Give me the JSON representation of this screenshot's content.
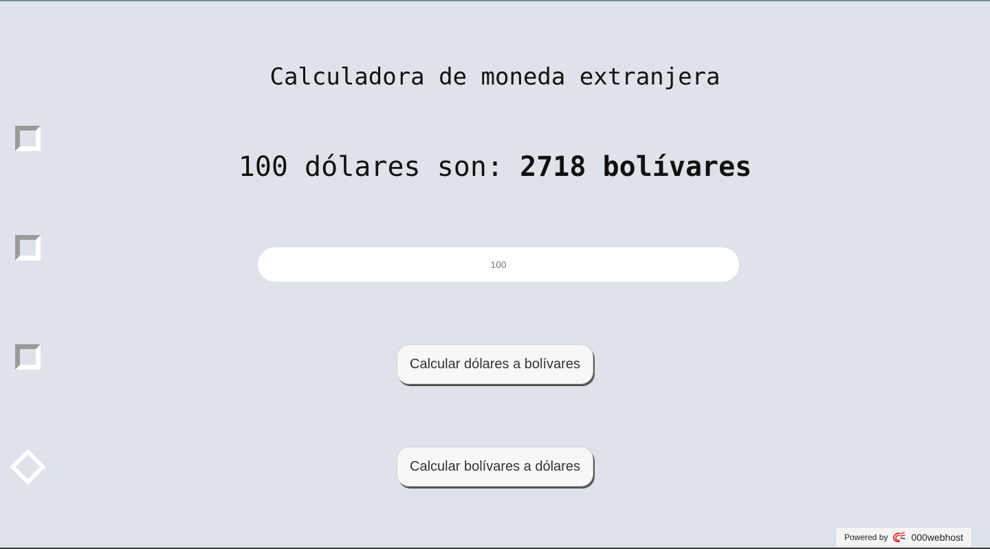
{
  "header": {
    "title": "Calculadora de moneda extranjera"
  },
  "result": {
    "prefix": "100 dólares son: ",
    "amount": "2718 bolívares"
  },
  "amount_input": {
    "value": "",
    "placeholder": "100"
  },
  "buttons": {
    "usd_to_bs_label": "Calcular dólares a bolívares",
    "bs_to_usd_label": "Calcular bolívares a dólares"
  },
  "footer": {
    "powered_label": "Powered by",
    "host_name": "000webhost",
    "logo_icon": "000webhost-swirl-icon"
  },
  "colors": {
    "background": "#dde3e9",
    "input_background": "#ffffff",
    "button_background": "#f7f7f7",
    "logo_accent": "#d9232d"
  }
}
